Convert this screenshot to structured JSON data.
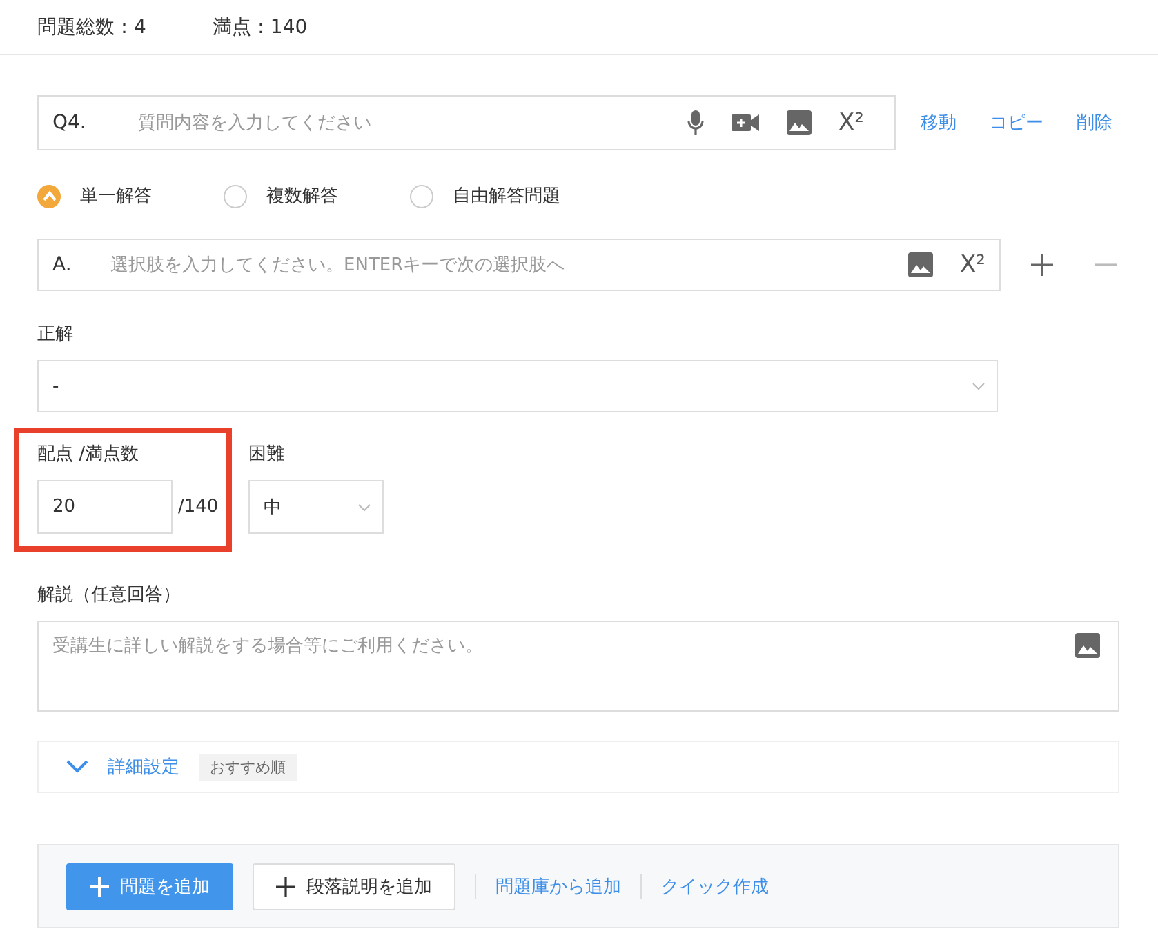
{
  "summary": {
    "total": "問題総数：4",
    "full_score": "満点：140"
  },
  "question": {
    "number": "Q4.",
    "placeholder": "質問内容を入力してください",
    "superscript_label": "X²",
    "actions": [
      "移動",
      "コピー",
      "削除"
    ]
  },
  "question_types": [
    {
      "label": "単一解答",
      "selected": true
    },
    {
      "label": "複数解答",
      "selected": false
    },
    {
      "label": "自由解答問題",
      "selected": false
    }
  ],
  "options": [
    {
      "letter": "A.",
      "placeholder": "選択肢を入力してください。ENTERキーで次の選択肢へ",
      "superscript_label": "X²"
    }
  ],
  "correct_answer": {
    "label": "正解",
    "value": "-"
  },
  "score": {
    "label": "配点 /満点数",
    "value": "20",
    "max": "/140",
    "highlighted": true
  },
  "difficulty": {
    "label": "困難",
    "value": "中"
  },
  "explanation": {
    "label": "解説（任意回答）",
    "placeholder": "受講生に詳しい解説をする場合等にご利用ください。"
  },
  "advanced": {
    "label": "詳細設定",
    "tag": "おすすめ順",
    "expanded": false
  },
  "footer": {
    "primary": "問題を追加",
    "secondary": "段落説明を追加",
    "links": [
      "問題庫から追加",
      "クイック作成"
    ]
  }
}
